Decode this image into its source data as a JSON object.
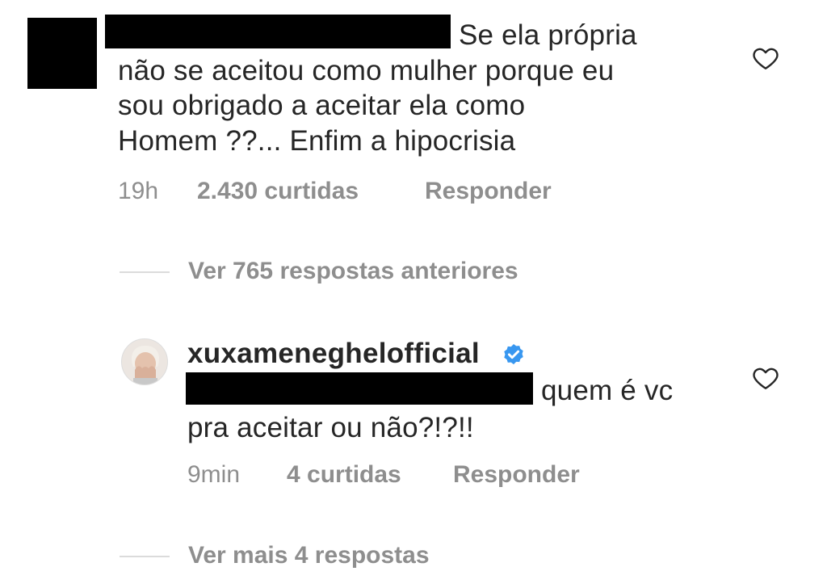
{
  "comment1": {
    "text_line1": "Se ela própria",
    "text_line2": "não se aceitou como mulher porque eu",
    "text_line3": "sou obrigado a aceitar ela como",
    "text_line4": "Homem ??... Enfim a hipocrisia",
    "time": "19h",
    "likes": "2.430 curtidas",
    "reply": "Responder"
  },
  "view_previous": "Ver 765 respostas anteriores",
  "reply1": {
    "username": "xuxameneghelofficial",
    "text_line1": "quem é vc",
    "text_line2": "pra aceitar ou não?!?!!",
    "time": "9min",
    "likes": "4 curtidas",
    "reply": "Responder"
  },
  "view_more": "Ver mais 4 respostas",
  "icons": {
    "like": "heart-outline-icon",
    "verified": "verified-badge-icon"
  },
  "colors": {
    "text": "#262626",
    "secondary": "#8e8e8e",
    "verified": "#3897f0"
  }
}
